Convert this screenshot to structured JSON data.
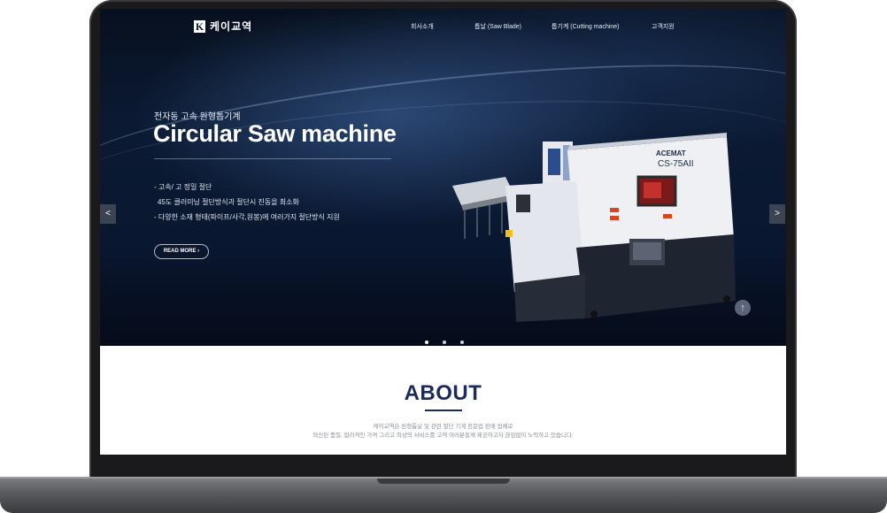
{
  "brand": {
    "logo_letter": "K",
    "name": "케이교역"
  },
  "nav": {
    "items": [
      {
        "label": "회사소개"
      },
      {
        "label": "톱날 (Saw Blade)"
      },
      {
        "label": "톱기계 (Cutting machine)"
      },
      {
        "label": "고객지원"
      }
    ]
  },
  "hero": {
    "subtitle": "전자동 고속 원형톱기계",
    "title": "Circular Saw machine",
    "bullets": [
      "- 고속/ 고 정밀 절단",
      "  45도 클러미닝 절단방식과 절단시 진동을 최소화",
      "- 다양한 소재 형태(파이프/사각,원봉)에 여러가지 절단방식 지원"
    ],
    "read_more": "READ MORE",
    "prev_label": "<",
    "next_label": ">",
    "machine_brand": "ACEMAT",
    "machine_model": "CS-75AII"
  },
  "about": {
    "title": "ABOUT",
    "lines": [
      "케이교역은 원형톱날 및 관련 절단 기계 전문업 판매 업체로",
      "혁신된 품질, 합리적인 가격 그리고 최상의 서비스를 고객 여러분들께 제공하고자 끊임없이 노력하고 있습니다."
    ]
  },
  "colors": {
    "accent": "#1d2a5e",
    "hero_dark": "#0b1a33"
  }
}
